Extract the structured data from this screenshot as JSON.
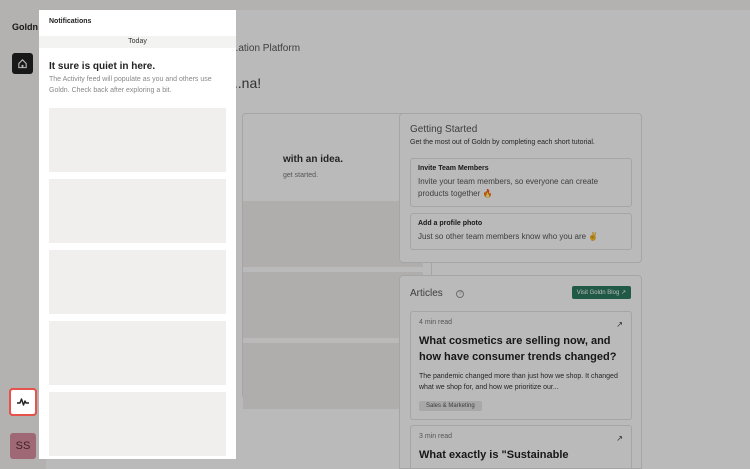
{
  "app": {
    "logo": "Goldn"
  },
  "rail": {
    "avatar_initials": "SS"
  },
  "main": {
    "title": "...ation Platform",
    "greeting": "...na!",
    "idea_card": {
      "headline": "with an idea.",
      "sub": "get started."
    },
    "getting_started": {
      "title": "Getting Started",
      "subtitle": "Get the most out of Goldn by completing each short tutorial.",
      "items": [
        {
          "title": "Invite Team Members",
          "desc": "Invite your team members, so everyone can create products together 🔥"
        },
        {
          "title": "Add a profile photo",
          "desc": "Just so other team members know who you are ✌️"
        }
      ]
    },
    "articles": {
      "title": "Articles",
      "help": "?",
      "blog_button": "Visit Goldn Blog",
      "items": [
        {
          "read_time": "4 min read",
          "headline": "What cosmetics are selling now, and how have consumer trends changed?",
          "excerpt": "The pandemic changed more than just how we shop. It changed what we shop for, and how we prioritize our...",
          "tag": "Sales & Marketing"
        },
        {
          "read_time": "3 min read",
          "headline": "What exactly is \"Sustainable"
        }
      ]
    }
  },
  "notifications": {
    "title": "Notifications",
    "section": "Today",
    "empty_title": "It sure is quiet in here.",
    "empty_sub": "The Activity feed will populate as you and others use Goldn. Check back after exploring a bit."
  },
  "colors": {
    "accent": "#e0a23a",
    "blog_button": "#2d7a5f",
    "highlight": "#e5534b"
  },
  "icons": {
    "home": "home-icon",
    "activity": "activity-icon",
    "external": "external-link-icon"
  }
}
